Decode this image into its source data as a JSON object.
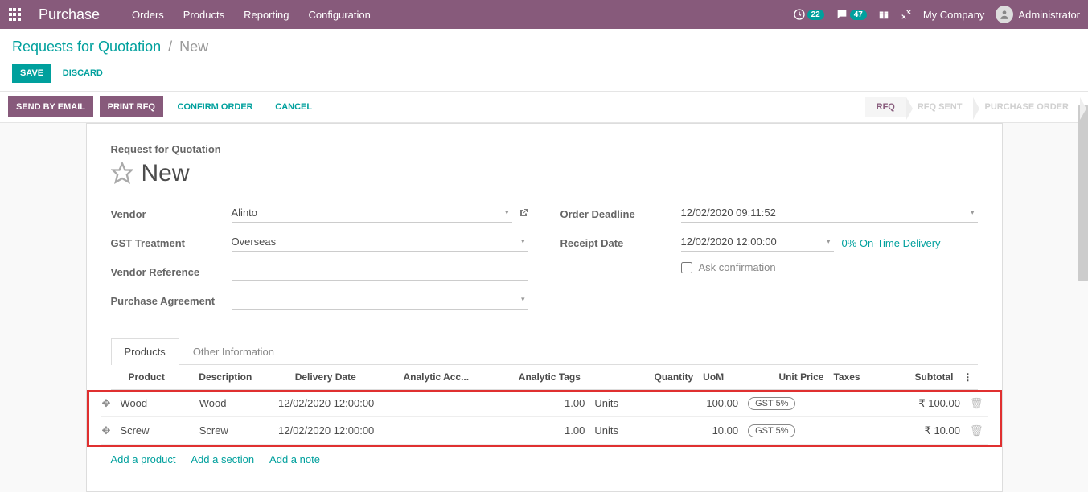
{
  "navbar": {
    "brand": "Purchase",
    "menu": [
      "Orders",
      "Products",
      "Reporting",
      "Configuration"
    ],
    "clock_badge": "22",
    "chat_badge": "47",
    "company": "My Company",
    "user": "Administrator"
  },
  "breadcrumb": {
    "root": "Requests for Quotation",
    "current": "New"
  },
  "buttons": {
    "save": "Save",
    "discard": "Discard",
    "send_email": "Send by Email",
    "print_rfq": "Print RFQ",
    "confirm": "Confirm Order",
    "cancel": "Cancel"
  },
  "stages": [
    "RFQ",
    "RFQ Sent",
    "Purchase Order"
  ],
  "form": {
    "subtitle": "Request for Quotation",
    "title": "New",
    "labels": {
      "vendor": "Vendor",
      "gst": "GST Treatment",
      "vendor_ref": "Vendor Reference",
      "purchase_agreement": "Purchase Agreement",
      "order_deadline": "Order Deadline",
      "receipt_date": "Receipt Date",
      "ask_confirm": "Ask confirmation"
    },
    "values": {
      "vendor": "Alinto",
      "gst": "Overseas",
      "vendor_ref": "",
      "purchase_agreement": "",
      "order_deadline": "12/02/2020 09:11:52",
      "receipt_date": "12/02/2020 12:00:00",
      "on_time": "0% On-Time Delivery"
    }
  },
  "tabs": [
    "Products",
    "Other Information"
  ],
  "table": {
    "headers": {
      "product": "Product",
      "description": "Description",
      "delivery_date": "Delivery Date",
      "analytic_acc": "Analytic Acc...",
      "analytic_tags": "Analytic Tags",
      "quantity": "Quantity",
      "uom": "UoM",
      "unit_price": "Unit Price",
      "taxes": "Taxes",
      "subtotal": "Subtotal"
    },
    "rows": [
      {
        "product": "Wood",
        "description": "Wood",
        "delivery_date": "12/02/2020 12:00:00",
        "analytic_acc": "",
        "analytic_tags": "",
        "quantity": "1.00",
        "uom": "Units",
        "unit_price": "100.00",
        "taxes": "GST 5%",
        "subtotal": "₹ 100.00"
      },
      {
        "product": "Screw",
        "description": "Screw",
        "delivery_date": "12/02/2020 12:00:00",
        "analytic_acc": "",
        "analytic_tags": "",
        "quantity": "1.00",
        "uom": "Units",
        "unit_price": "10.00",
        "taxes": "GST 5%",
        "subtotal": "₹ 10.00"
      }
    ],
    "add_links": [
      "Add a product",
      "Add a section",
      "Add a note"
    ]
  }
}
